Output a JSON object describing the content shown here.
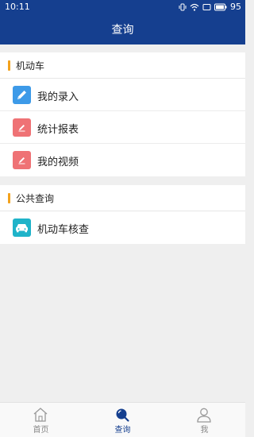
{
  "status": {
    "time": "10:11",
    "battery": "95"
  },
  "appbar": {
    "title": "查询"
  },
  "sections": [
    {
      "header": "机动车",
      "items": [
        {
          "label": "我的录入",
          "icon": "pencil-icon",
          "color": "#3d9ae8"
        },
        {
          "label": "统计报表",
          "icon": "pencil-icon",
          "color": "#ef7275"
        },
        {
          "label": "我的视频",
          "icon": "pencil-icon",
          "color": "#ef7275"
        }
      ]
    },
    {
      "header": "公共查询",
      "items": [
        {
          "label": "机动车核查",
          "icon": "car-icon",
          "color": "#1fb3c9"
        }
      ]
    }
  ],
  "tabs": [
    {
      "label": "首页",
      "icon": "home-icon",
      "active": false
    },
    {
      "label": "查询",
      "icon": "search-icon",
      "active": true
    },
    {
      "label": "我",
      "icon": "user-icon",
      "active": false
    }
  ],
  "colors": {
    "primary": "#153f8f",
    "accent_bar": "#f3a21d"
  }
}
